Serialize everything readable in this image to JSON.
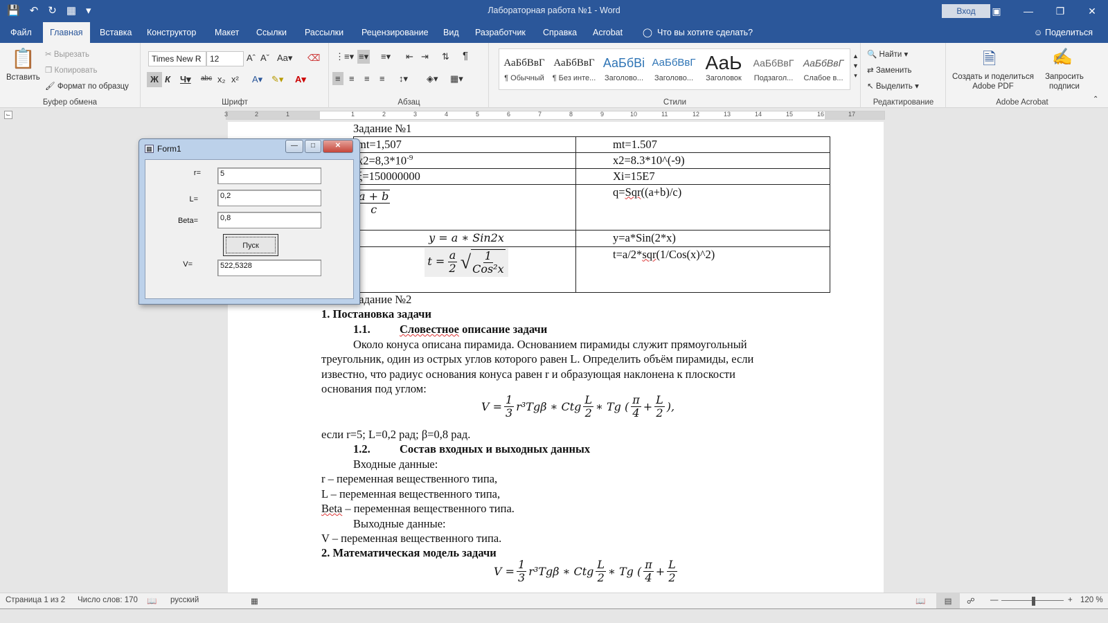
{
  "window": {
    "title": "Лабораторная работа №1 - Word",
    "signin": "Вход"
  },
  "tabs": [
    "Файл",
    "Главная",
    "Вставка",
    "Конструктор",
    "Макет",
    "Ссылки",
    "Рассылки",
    "Рецензирование",
    "Вид",
    "Разработчик",
    "Справка",
    "Acrobat",
    "Что вы хотите сделать?"
  ],
  "share": "Поделиться",
  "clipboard": {
    "paste": "Вставить",
    "cut": "Вырезать",
    "copy": "Копировать",
    "format": "Формат по образцу",
    "label": "Буфер обмена"
  },
  "font": {
    "name": "Times New R",
    "size": "12",
    "label": "Шрифт"
  },
  "paragraph": {
    "label": "Абзац"
  },
  "styles": {
    "items": [
      {
        "preview": "АаБбВвГ",
        "label": "¶ Обычный"
      },
      {
        "preview": "АаБбВвГ",
        "label": "¶ Без инте..."
      },
      {
        "preview": "АаБбВі",
        "label": "Заголово..."
      },
      {
        "preview": "АаБбВвГ",
        "label": "Заголово..."
      },
      {
        "preview": "АаЬ",
        "label": "Заголовок"
      },
      {
        "preview": "АаБбВвГ",
        "label": "Подзагол..."
      },
      {
        "preview": "АаБбВвГ",
        "label": "Слабое в..."
      }
    ],
    "label": "Стили"
  },
  "editing": {
    "find": "Найти",
    "replace": "Заменить",
    "select": "Выделить",
    "label": "Редактирование"
  },
  "acrobat": {
    "create": "Создать и поделиться Adobe PDF",
    "request": "Запросить подписи",
    "label": "Adobe Acrobat"
  },
  "ruler": {
    "marks": [
      "3",
      "2",
      "1",
      "1",
      "2",
      "3",
      "4",
      "5",
      "6",
      "7",
      "8",
      "9",
      "10",
      "11",
      "12",
      "13",
      "14",
      "15",
      "16",
      "17"
    ]
  },
  "document": {
    "task1": "Задание №1",
    "table": [
      {
        "left": "mt=1,507",
        "right": "mt=1.507"
      },
      {
        "left": "x2=8,3*10",
        "left_sup": "-9",
        "right": "x2=8.3*10^(-9)"
      },
      {
        "left": "ξ=150000000",
        "right": "Xi=15E7"
      },
      {
        "left_num": "a + b",
        "left_den": "c",
        "right": "q=Sqr((a+b)/c)"
      },
      {
        "left": "y = a ∗ Sin2x",
        "right": "y=a*Sin(2*x)"
      },
      {
        "left_t": "t =",
        "left_a": "a",
        "left_2": "2",
        "left_one": "1",
        "left_cos": "Cos²x",
        "right": "t=a/2*sqr(1/Cos(x)^2)"
      }
    ],
    "task2": "Задание №2",
    "h1": "1.   Постановка задачи",
    "h11_num": "1.1.",
    "h11": "Словестное описание задачи",
    "para1": "Около конуса описана пирамида. Основанием пирамиды служит прямоугольный",
    "para2": "треугольник, один из острых углов которого равен L. Определить объём пирамиды, если",
    "para3": "известно, что радиус основания конуса равен r и образующая наклонена к плоскости",
    "para4": "основания под углом:",
    "formula_v": "V =",
    "formula_1": "1",
    "formula_3": "3",
    "formula_mid": "r³Tgβ ∗ Ctg",
    "formula_L": "L",
    "formula_2": "2",
    "formula_tg": "∗ Tg (",
    "formula_pi": "π",
    "formula_4": "4",
    "formula_plus": "+",
    "formula_end": "),",
    "given": "если r=5; L=0,2 рад; β=0,8 рад.",
    "h12_num": "1.2.",
    "h12": "Состав входных и выходных данных",
    "inputs": "Входные данные:",
    "var_r": "r – переменная вещественного типа,",
    "var_L": "L – переменная вещественного типа,",
    "var_beta_name": "Beta",
    "var_beta": " – переменная вещественного типа.",
    "outputs": "Выходные данные:",
    "var_V": "V – переменная вещественного типа.",
    "h2": "2.   Математическая модель задачи"
  },
  "form1": {
    "title": "Form1",
    "fields": [
      {
        "label": "r=",
        "value": "5"
      },
      {
        "label": "L=",
        "value": "0,2"
      },
      {
        "label": "Beta=",
        "value": "0,8"
      }
    ],
    "button": "Пуск",
    "result_label": "V=",
    "result_value": "522,5328"
  },
  "status": {
    "page": "Страница 1 из 2",
    "words": "Число слов: 170",
    "lang": "русский",
    "zoom": "120 %"
  }
}
